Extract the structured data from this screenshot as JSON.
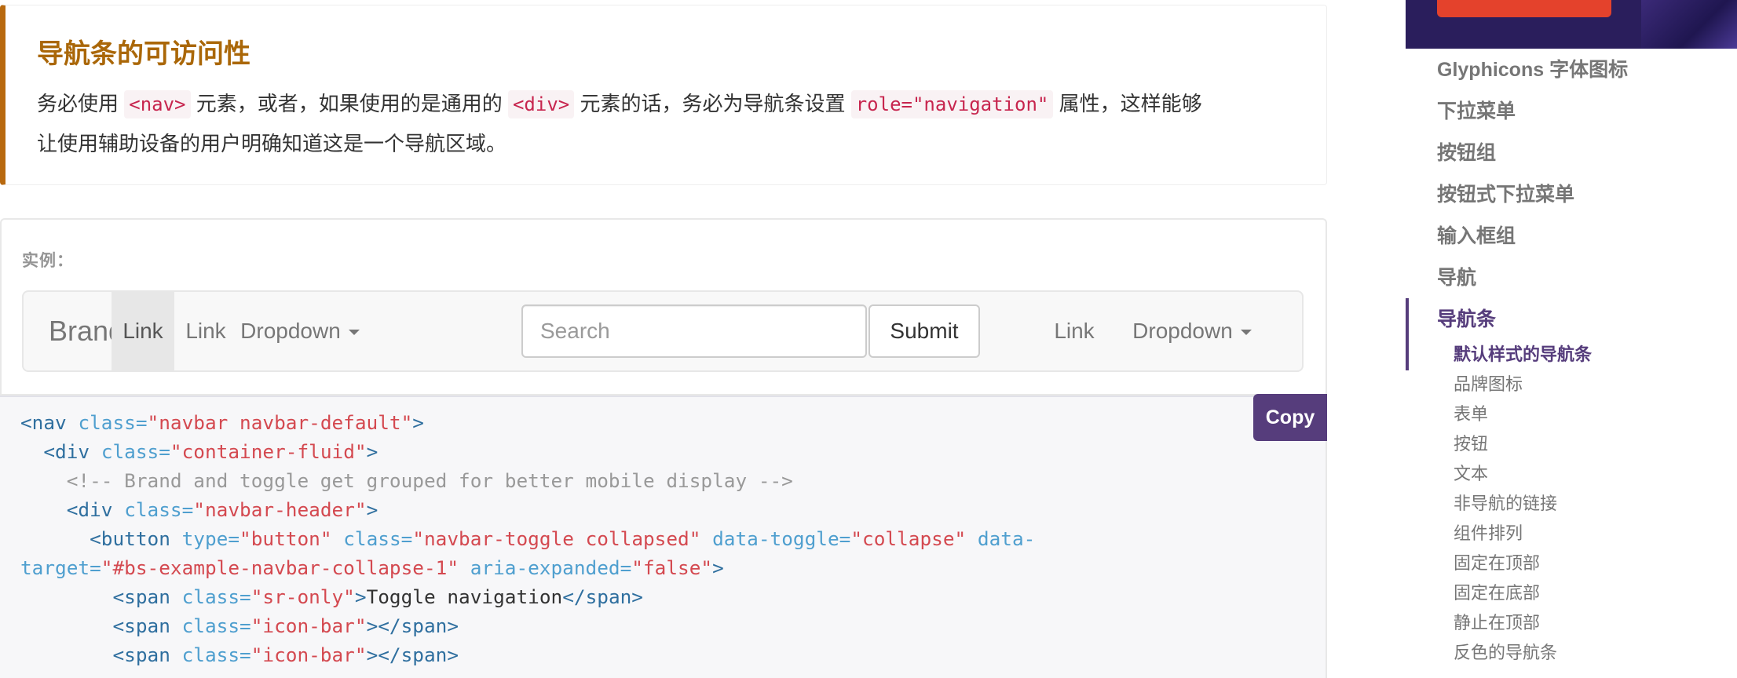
{
  "callout": {
    "title": "导航条的可访问性",
    "text_1": "务必使用",
    "code_nav": "<nav>",
    "text_2": "元素，或者，如果使用的是通用的",
    "code_div": "<div>",
    "text_3": "元素的话，务必为导航条设置",
    "code_role": "role=\"navigation\"",
    "text_4": "属性，这样能够",
    "text_5": "让使用辅助设备的用户明确知道这是一个导航区域。"
  },
  "example": {
    "label": "实例：",
    "navbar": {
      "brand": "Brand",
      "link_active": "Link",
      "link_2": "Link",
      "dropdown_1": "Dropdown",
      "search_placeholder": "Search",
      "submit": "Submit",
      "link_right": "Link",
      "dropdown_2": "Dropdown"
    }
  },
  "code": {
    "copy_label": "Copy",
    "l1_open": "<nav ",
    "l1_attr": "class=",
    "l1_val": "\"navbar navbar-default\"",
    "l1_close": ">",
    "l2_open": "<div ",
    "l2_attr": "class=",
    "l2_val": "\"container-fluid\"",
    "l2_close": ">",
    "l3_comment": "<!-- Brand and toggle get grouped for better mobile display -->",
    "l4_open": "<div ",
    "l4_attr": "class=",
    "l4_val": "\"navbar-header\"",
    "l4_close": ">",
    "l5_open": "<button ",
    "l5_a1": "type=",
    "l5_v1": "\"button\"",
    "l5_a2": "class=",
    "l5_v2": "\"navbar-toggle collapsed\"",
    "l5_a3": "data-toggle=",
    "l5_v3": "\"collapse\"",
    "l5_a4": "data-",
    "l6_a1": "target=",
    "l6_v1": "\"#bs-example-navbar-collapse-1\"",
    "l6_a2": "aria-expanded=",
    "l6_v2": "\"false\"",
    "l6_close": ">",
    "l7_open": "<span ",
    "l7_attr": "class=",
    "l7_val": "\"sr-only\"",
    "l7_gt": ">",
    "l7_text": "Toggle navigation",
    "l7_end": "</span>",
    "l8_open": "<span ",
    "l8_attr": "class=",
    "l8_val": "\"icon-bar\"",
    "l8_end": "></span>",
    "l9_open": "<span ",
    "l9_attr": "class=",
    "l9_val": "\"icon-bar\"",
    "l9_end": "></span>"
  },
  "sidebar": {
    "items": [
      "Glyphicons 字体图标",
      "下拉菜单",
      "按钮组",
      "按钮式下拉菜单",
      "输入框组",
      "导航",
      "导航条"
    ],
    "subitems": [
      "默认样式的导航条",
      "品牌图标",
      "表单",
      "按钮",
      "文本",
      "非导航的链接",
      "组件排列",
      "固定在顶部",
      "固定在底部",
      "静止在顶部",
      "反色的导航条"
    ]
  },
  "colors": {
    "callout_border": "#b8690f",
    "callout_title": "#aa6708",
    "accent": "#563d7c",
    "code_string": "#d44950",
    "code_tag": "#2f6f9f",
    "code_attr": "#4f9fcf"
  }
}
